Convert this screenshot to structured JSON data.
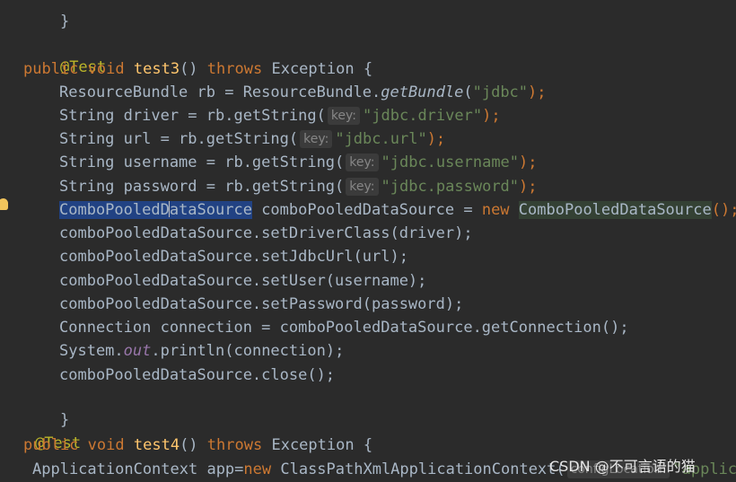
{
  "code": {
    "l0": {
      "brace": "}"
    },
    "l1": {
      "annotation": "@Test"
    },
    "l2": {
      "kw_public": "public",
      "kw_void": "void",
      "method": "test3",
      "parens": "()",
      "kw_throws": "throws",
      "exception": "Exception {"
    },
    "l3": {
      "text1": "ResourceBundle rb = ResourceBundle.",
      "method": "getBundle",
      "open": "(",
      "str": "\"jdbc\"",
      "close": ");"
    },
    "l4": {
      "text1": "String driver = rb.getString(",
      "hint": "key:",
      "str": "\"jdbc.driver\"",
      "close": ");"
    },
    "l5": {
      "text1": "String url = rb.getString(",
      "hint": "key:",
      "str": "\"jdbc.url\"",
      "close": ");"
    },
    "l6": {
      "text1": "String username = rb.getString(",
      "hint": "key:",
      "str": "\"jdbc.username\"",
      "close": ");"
    },
    "l7": {
      "text1": "String password = rb.getString(",
      "hint": "key:",
      "str": "\"jdbc.password\"",
      "close": ");"
    },
    "l8": {
      "sel_a": "ComboPooledD",
      "sel_b": "ataSource",
      "text1": " comboPooledDataSource = ",
      "kw_new": "new",
      "cls": "ComboPooledDataSource",
      "close": "();"
    },
    "l9": {
      "text": "comboPooledDataSource.setDriverClass(driver);"
    },
    "l10": {
      "text": "comboPooledDataSource.setJdbcUrl(url);"
    },
    "l11": {
      "text": "comboPooledDataSource.setUser(username);"
    },
    "l12": {
      "text": "comboPooledDataSource.setPassword(password);"
    },
    "l13": {
      "text": "Connection connection = comboPooledDataSource.getConnection();"
    },
    "l14": {
      "pre": "System.",
      "field": "out",
      "post": ".println(connection);"
    },
    "l15": {
      "text": "comboPooledDataSource.close();"
    },
    "l16": {
      "brace": "}"
    },
    "l17": {
      "annotation": "@Test"
    },
    "l18": {
      "kw_public": "public",
      "kw_void": "void",
      "method": "test4",
      "parens": "()",
      "kw_throws": "throws",
      "exception": "Exception {"
    },
    "l19": {
      "text1": "ApplicationContext app=",
      "kw_new": "new",
      "text2": " ClassPathXmlApplicationContext(",
      "hint": "configLocation:",
      "str": "\"applica"
    }
  },
  "watermark": "CSDN @不可言语的猫",
  "colors": {
    "background": "#2b2b2b",
    "keyword": "#cc7832",
    "annotation": "#bbb529",
    "method_decl": "#ffc66d",
    "string": "#6a8759",
    "default_text": "#a9b7c6",
    "static_field": "#9876aa",
    "selection": "#214283"
  },
  "icons": {
    "gutter": "intention-bulb-icon"
  }
}
